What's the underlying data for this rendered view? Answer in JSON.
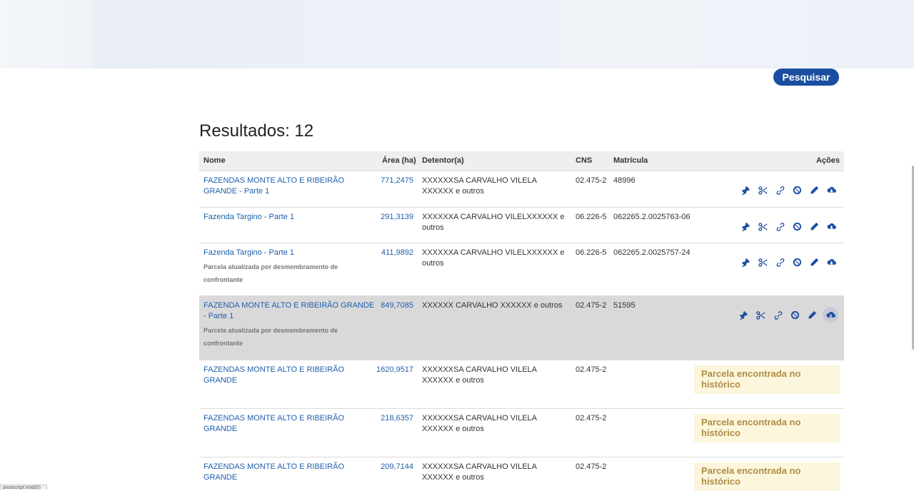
{
  "search": {
    "button_label": "Pesquisar"
  },
  "results": {
    "title": "Resultados: 12"
  },
  "table": {
    "headers": {
      "nome": "Nome",
      "area": "Área (ha)",
      "detentor": "Detentor(a)",
      "cns": "CNS",
      "matricula": "Matrícula",
      "acoes": "Ações"
    },
    "rows": [
      {
        "nome": "FAZENDAS MONTE ALTO E RIBEIRÃO GRANDE - Parte 1",
        "sub": "",
        "area": "771,2475",
        "detentor": "XXXXXXSA CARVALHO VILELA XXXXXX e outros",
        "cns": "02.475-2",
        "matricula": "48996",
        "notice": ""
      },
      {
        "nome": "Fazenda Targino - Parte 1",
        "sub": "",
        "area": "291,3139",
        "detentor": "XXXXXXA CARVALHO VILELXXXXXX e outros",
        "cns": "06.226-5",
        "matricula": "062265.2.0025763-06",
        "notice": ""
      },
      {
        "nome": "Fazenda Targino - Parte 1",
        "sub": "Parcela atualizada por desmembramento de confrontante",
        "area": "411,9892",
        "detentor": "XXXXXXA CARVALHO VILELXXXXXX e outros",
        "cns": "06.226-5",
        "matricula": "062265.2.0025757-24",
        "notice": ""
      },
      {
        "nome": "FAZENDA MONTE ALTO E RIBEIRÃO GRANDE - Parte 1",
        "sub": "Parcela atualizada por desmembramento de confrontante",
        "area": "849,7085",
        "detentor": "XXXXXX CARVALHO XXXXXX e outros",
        "cns": "02.475-2",
        "matricula": "51595",
        "notice": ""
      },
      {
        "nome": "FAZENDAS MONTE ALTO E RIBEIRÃO GRANDE",
        "sub": "",
        "area": "1620,9517",
        "detentor": "XXXXXXSA CARVALHO VILELA XXXXXX e outros",
        "cns": "02.475-2",
        "matricula": "",
        "notice": "Parcela encontrada no histórico"
      },
      {
        "nome": "FAZENDAS MONTE ALTO E RIBEIRÃO GRANDE",
        "sub": "",
        "area": "218,6357",
        "detentor": "XXXXXXSA CARVALHO VILELA XXXXXX e outros",
        "cns": "02.475-2",
        "matricula": "",
        "notice": "Parcela encontrada no histórico"
      },
      {
        "nome": "FAZENDAS MONTE ALTO E RIBEIRÃO GRANDE",
        "sub": "",
        "area": "209,7144",
        "detentor": "XXXXXXSA CARVALHO VILELA XXXXXX e outros",
        "cns": "02.475-2",
        "matricula": "",
        "notice": "Parcela encontrada no histórico"
      }
    ],
    "action_icons": [
      "gavel-icon",
      "scissors-icon",
      "link-icon",
      "ban-icon",
      "pencil-icon",
      "cloud-download-icon"
    ]
  },
  "statusbar": {
    "text": "javascript:void(0)"
  },
  "colors": {
    "primary": "#1a4ea0",
    "link": "#1f5fae",
    "notice_bg": "#fcf6dd",
    "notice_text": "#b08d45",
    "highlight_row": "#d9d9d9"
  }
}
